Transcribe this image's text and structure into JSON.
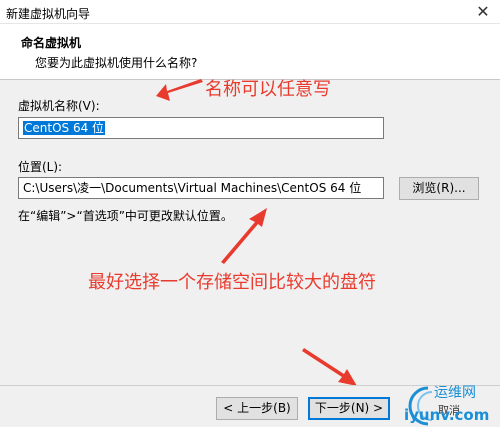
{
  "window": {
    "title": "新建虚拟机向导",
    "close_glyph": "✕"
  },
  "header": {
    "title": "命名虚拟机",
    "subtitle": "您要为此虚拟机使用什么名称?"
  },
  "form": {
    "name_label": "虚拟机名称(V):",
    "name_value": "CentOS 64 位",
    "location_label": "位置(L):",
    "location_value": "C:\\Users\\凌一\\Documents\\Virtual Machines\\CentOS 64 位",
    "browse_label": "浏览(R)...",
    "hint": "在“编辑”>“首选项”中可更改默认位置。"
  },
  "annotations": {
    "name_note": "名称可以任意写",
    "location_note": "最好选择一个存储空间比较大的盘符",
    "color": "#e83b2e"
  },
  "footer": {
    "back_label": "< 上一步(B)",
    "next_label": "下一步(N) >",
    "cancel_label": "取消"
  },
  "watermark": {
    "cn": "运维网",
    "en": "iyunv.com",
    "color": "#1b8fd6"
  }
}
